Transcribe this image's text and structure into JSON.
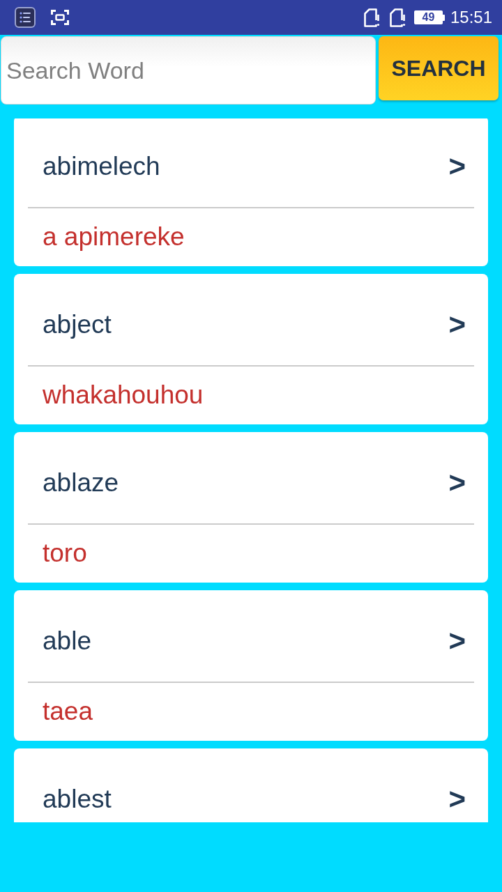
{
  "status_bar": {
    "battery": "49",
    "time": "15:51"
  },
  "search": {
    "placeholder": "Search Word",
    "button": "SEARCH"
  },
  "entries": [
    {
      "word": "abimelech",
      "arrow": ">",
      "translation": "a apimereke"
    },
    {
      "word": "abject",
      "arrow": ">",
      "translation": "whakahouhou"
    },
    {
      "word": "ablaze",
      "arrow": ">",
      "translation": "toro"
    },
    {
      "word": "able",
      "arrow": ">",
      "translation": "taea"
    },
    {
      "word": "ablest",
      "arrow": ">"
    }
  ]
}
